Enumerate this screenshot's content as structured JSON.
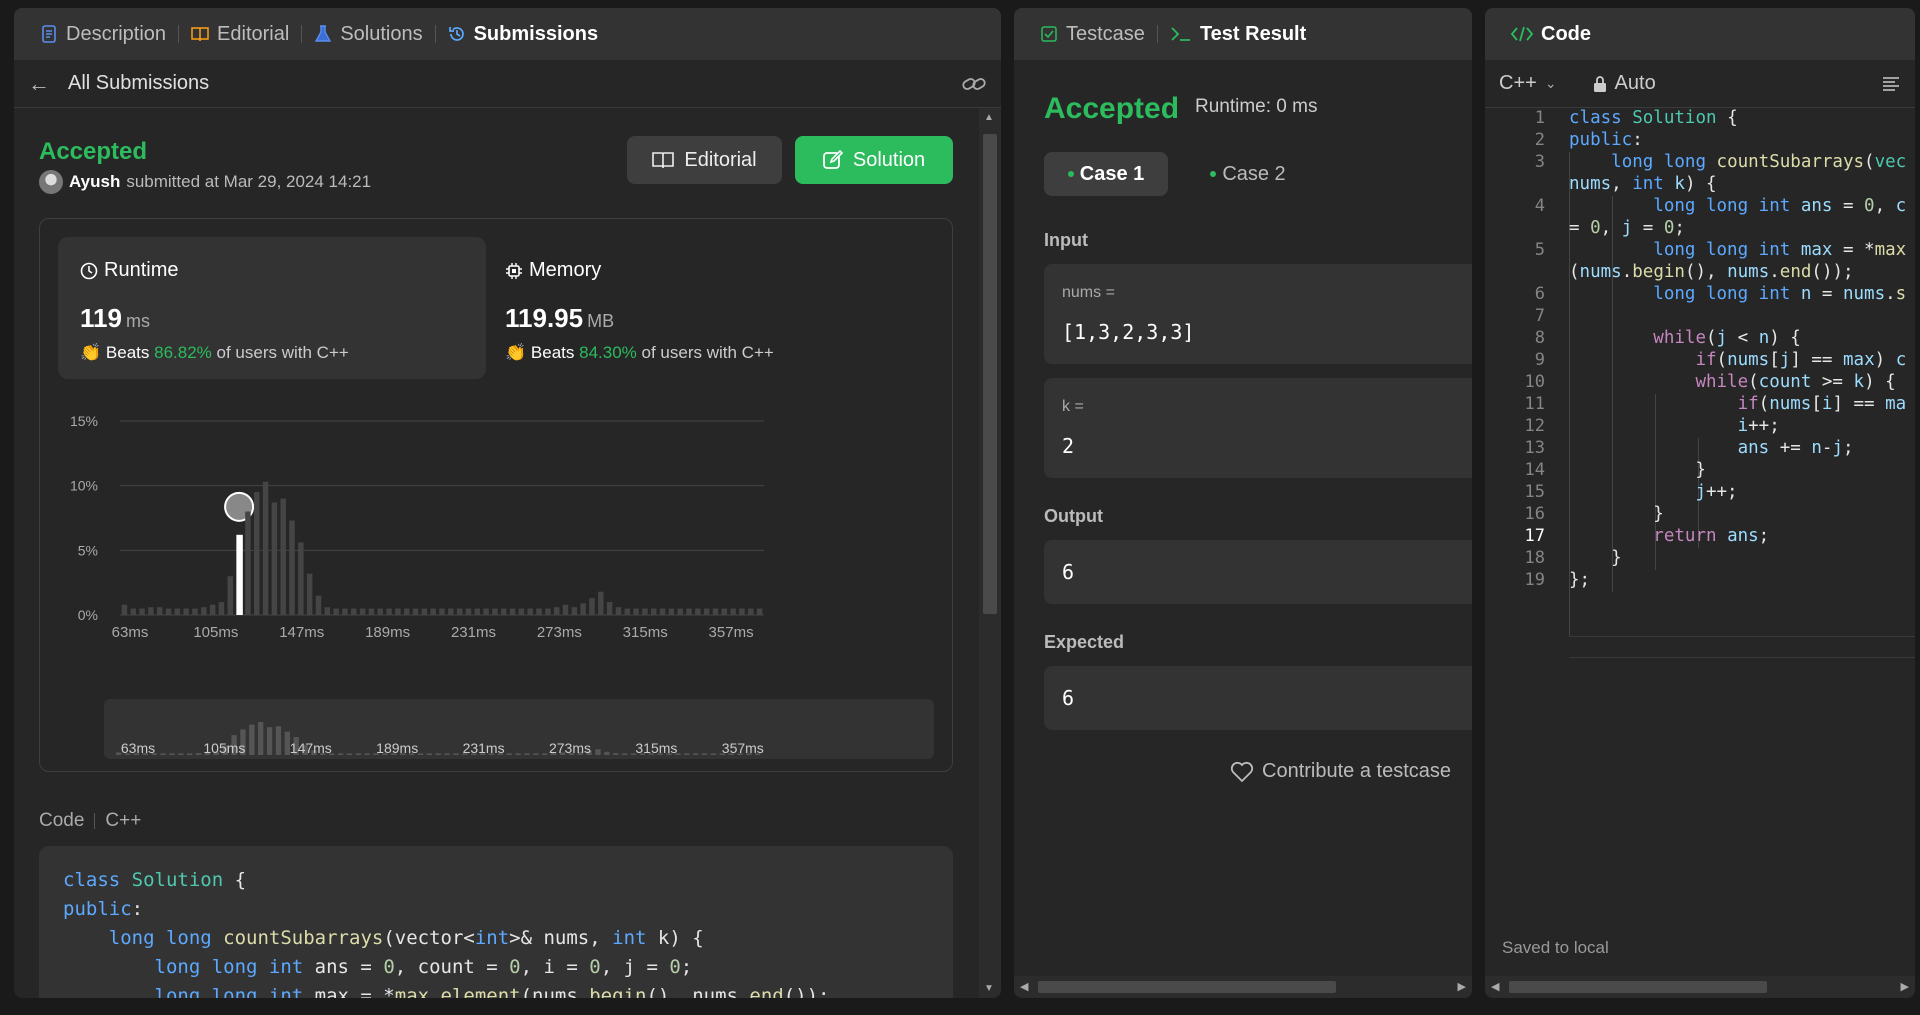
{
  "left_tabs": [
    {
      "label": "Description",
      "color": "#5a8dee"
    },
    {
      "label": "Editorial",
      "color": "#ffa116"
    },
    {
      "label": "Solutions",
      "color": "#5a8dee"
    },
    {
      "label": "Submissions",
      "color": "#5ca9ff"
    }
  ],
  "subheader": {
    "title": "All Submissions"
  },
  "submission": {
    "status": "Accepted",
    "user": "Ayush",
    "submitted_text": "submitted at Mar 29, 2024 14:21",
    "editorial_button": "Editorial",
    "solution_button": "Solution"
  },
  "runtime": {
    "label": "Runtime",
    "value": "119",
    "unit": "ms",
    "beats_label": "Beats",
    "beats_pct": "86.82%",
    "beats_suffix": "of users with C++"
  },
  "memory": {
    "label": "Memory",
    "value": "119.95",
    "unit": "MB",
    "beats_label": "Beats",
    "beats_pct": "84.30%",
    "beats_suffix": "of users with C++"
  },
  "chart_data": {
    "type": "bar",
    "y_ticks": [
      "0%",
      "5%",
      "10%",
      "15%"
    ],
    "ylim": [
      0,
      15
    ],
    "x_ticks": [
      "63ms",
      "105ms",
      "147ms",
      "189ms",
      "231ms",
      "273ms",
      "315ms",
      "357ms"
    ],
    "values": [
      0.8,
      0.5,
      0.5,
      0.6,
      0.6,
      0.5,
      0.5,
      0.5,
      0.5,
      0.6,
      0.8,
      1.0,
      3.0,
      6.2,
      8.0,
      9.5,
      10.3,
      8.7,
      9.0,
      7.3,
      5.6,
      3.2,
      1.5,
      0.6,
      0.5,
      0.5,
      0.5,
      0.5,
      0.5,
      0.5,
      0.5,
      0.5,
      0.5,
      0.5,
      0.5,
      0.5,
      0.5,
      0.5,
      0.5,
      0.5,
      0.5,
      0.5,
      0.5,
      0.5,
      0.5,
      0.5,
      0.5,
      0.5,
      0.5,
      0.6,
      0.8,
      0.6,
      0.9,
      1.3,
      1.8,
      1.0,
      0.6,
      0.5,
      0.5,
      0.5,
      0.5,
      0.5,
      0.5,
      0.5,
      0.5,
      0.5,
      0.5,
      0.5,
      0.5,
      0.5,
      0.5,
      0.5,
      0.5
    ],
    "highlight_index": 13,
    "colors": {
      "bar": "#454545",
      "highlight": "#ffffff",
      "grid": "#444444"
    }
  },
  "code_section": {
    "label": "Code",
    "language": "C++"
  },
  "preview_code": [
    "class Solution {",
    "public:",
    "    long long countSubarrays(vector<int>& nums, int k) {",
    "        long long int ans = 0, count = 0, i = 0, j = 0;",
    "        long long int max = *max_element(nums.begin(), nums.end());"
  ],
  "mid_tabs": [
    {
      "label": "Testcase"
    },
    {
      "label": "Test Result"
    }
  ],
  "test_result": {
    "status": "Accepted",
    "runtime": "Runtime: 0 ms",
    "cases": [
      "Case 1",
      "Case 2"
    ],
    "input_label": "Input",
    "inputs": [
      {
        "name": "nums =",
        "value": "[1,3,2,3,3]"
      },
      {
        "name": "k =",
        "value": "2"
      }
    ],
    "output_label": "Output",
    "output": "6",
    "expected_label": "Expected",
    "expected": "6",
    "contribute": "Contribute a testcase"
  },
  "code_panel": {
    "title": "Code",
    "language": "C++",
    "mode": "Auto",
    "saved": "Saved to local",
    "current_line": 17
  },
  "editor_lines": [
    "1",
    "2",
    "3",
    "",
    "4",
    "",
    "5",
    "",
    "6",
    "7",
    "8",
    "9",
    "10",
    "11",
    "12",
    "13",
    "14",
    "15",
    "16",
    "17",
    "18",
    "19"
  ]
}
